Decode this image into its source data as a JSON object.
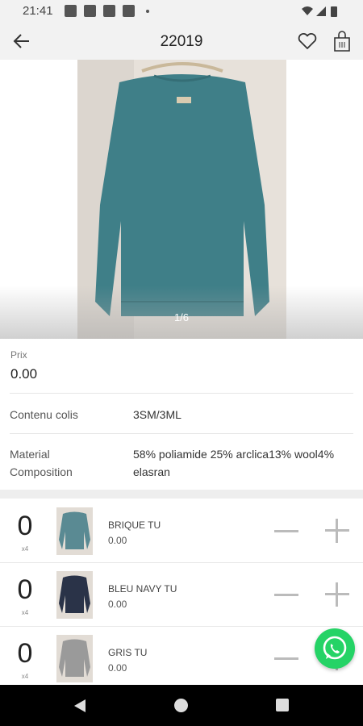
{
  "status_bar": {
    "time": "21:41"
  },
  "app_bar": {
    "title": "22019"
  },
  "gallery": {
    "counter": "1/6"
  },
  "price": {
    "label": "Prix",
    "value": "0.00"
  },
  "details": [
    {
      "label": "Contenu colis",
      "value": "3SM/3ML"
    },
    {
      "label": "Material\nComposition",
      "value": "58% poliamide 25% arclica13% wool4% elasran"
    }
  ],
  "variants": [
    {
      "qty": "0",
      "unit": "x4",
      "name": "BRIQUE TU",
      "price": "0.00",
      "color": "#5a8a93"
    },
    {
      "qty": "0",
      "unit": "x4",
      "name": "BLEU NAVY TU",
      "price": "0.00",
      "color": "#2a3348"
    },
    {
      "qty": "0",
      "unit": "x4",
      "name": "GRIS TU",
      "price": "0.00",
      "color": "#9a9a9a"
    }
  ],
  "icons": {
    "back": "arrow-left-icon",
    "favorite": "heart-icon",
    "bag": "shopping-bag-icon",
    "whatsapp": "whatsapp-icon"
  },
  "colors": {
    "sweater": "#3f7f88",
    "whatsapp": "#25d366"
  }
}
